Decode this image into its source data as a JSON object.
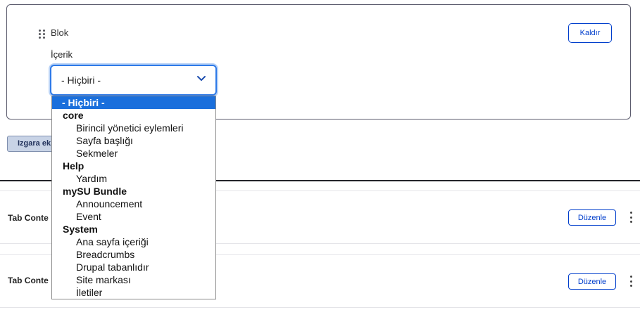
{
  "block_card": {
    "block_label": "Blok",
    "content_label": "İçerik",
    "remove_button": "Kaldır",
    "select_value": "- Hiçbiri -"
  },
  "grid_button": "Izgara ek",
  "rows": [
    {
      "title": "Tab Conte",
      "edit_button": "Düzenle"
    },
    {
      "title": "Tab Conte",
      "edit_button": "Düzenle"
    }
  ],
  "dropdown": {
    "selected": "- Hiçbiri -",
    "groups": [
      {
        "label": "core",
        "items": [
          "Birincil yönetici eylemleri",
          "Sayfa başlığı",
          "Sekmeler"
        ]
      },
      {
        "label": "Help",
        "items": [
          "Yardım"
        ]
      },
      {
        "label": "mySU Bundle",
        "items": [
          "Announcement",
          "Event"
        ]
      },
      {
        "label": "System",
        "items": [
          "Ana sayfa içeriği",
          "Breadcrumbs",
          "Drupal tabanlıdır",
          "Site markası",
          "İletiler"
        ]
      }
    ]
  },
  "colors": {
    "accent": "#003ecc",
    "selected_option_bg": "#1a6fdc",
    "focus_border": "#2e7ae8"
  },
  "icons": [
    "drag-handle-icon",
    "chevron-down-icon",
    "kebab-menu-icon"
  ]
}
